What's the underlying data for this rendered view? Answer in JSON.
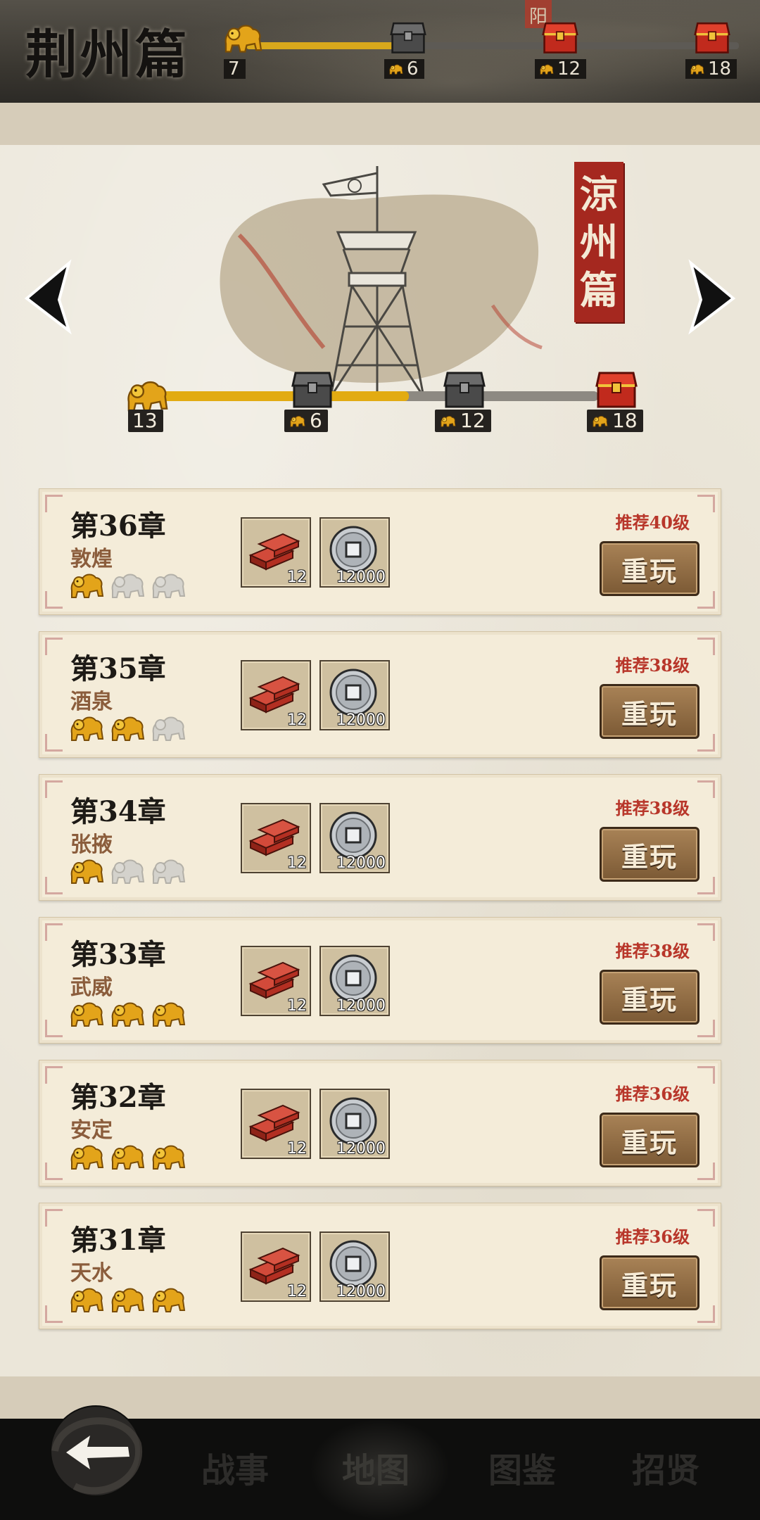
{
  "top_header": {
    "title": "荆州篇",
    "progress_fraction": 0.3,
    "total_stars": "7",
    "reward_counts": [
      "6",
      "12",
      "18"
    ],
    "map_mark": "阳"
  },
  "featured": {
    "seal_title": "涼州篇",
    "seal_chars": [
      "涼",
      "州",
      "篇"
    ],
    "progress_fraction": 0.58,
    "total_stars": "13",
    "reward_counts": [
      "6",
      "12",
      "18"
    ]
  },
  "chapters": [
    {
      "title": "第36章",
      "place": "敦煌",
      "stars": 1,
      "level": "推荐40级",
      "reward1_qty": "12",
      "reward2_qty": "12000",
      "button": "重玩"
    },
    {
      "title": "第35章",
      "place": "酒泉",
      "stars": 2,
      "level": "推荐38级",
      "reward1_qty": "12",
      "reward2_qty": "12000",
      "button": "重玩"
    },
    {
      "title": "第34章",
      "place": "张掖",
      "stars": 1,
      "level": "推荐38级",
      "reward1_qty": "12",
      "reward2_qty": "12000",
      "button": "重玩"
    },
    {
      "title": "第33章",
      "place": "武威",
      "stars": 3,
      "level": "推荐38级",
      "reward1_qty": "12",
      "reward2_qty": "12000",
      "button": "重玩"
    },
    {
      "title": "第32章",
      "place": "安定",
      "stars": 3,
      "level": "推荐36级",
      "reward1_qty": "12",
      "reward2_qty": "12000",
      "button": "重玩"
    },
    {
      "title": "第31章",
      "place": "天水",
      "stars": 3,
      "level": "推荐36级",
      "reward1_qty": "12",
      "reward2_qty": "12000",
      "button": "重玩"
    }
  ],
  "nav": {
    "items": [
      "战事",
      "地图",
      "图鉴",
      "招贤"
    ],
    "active": "地图"
  },
  "colors": {
    "accent_gold": "#e2ab12",
    "seal_red": "#a5281f",
    "level_red": "#b8362a"
  },
  "icons": {
    "back": "back-arrow-icon",
    "prev": "prev-arrow-icon",
    "next": "next-arrow-icon",
    "lion": "lion-star-icon",
    "chest": "treasure-chest-icon",
    "brick": "red-brick-icon",
    "coin": "copper-coin-icon"
  }
}
